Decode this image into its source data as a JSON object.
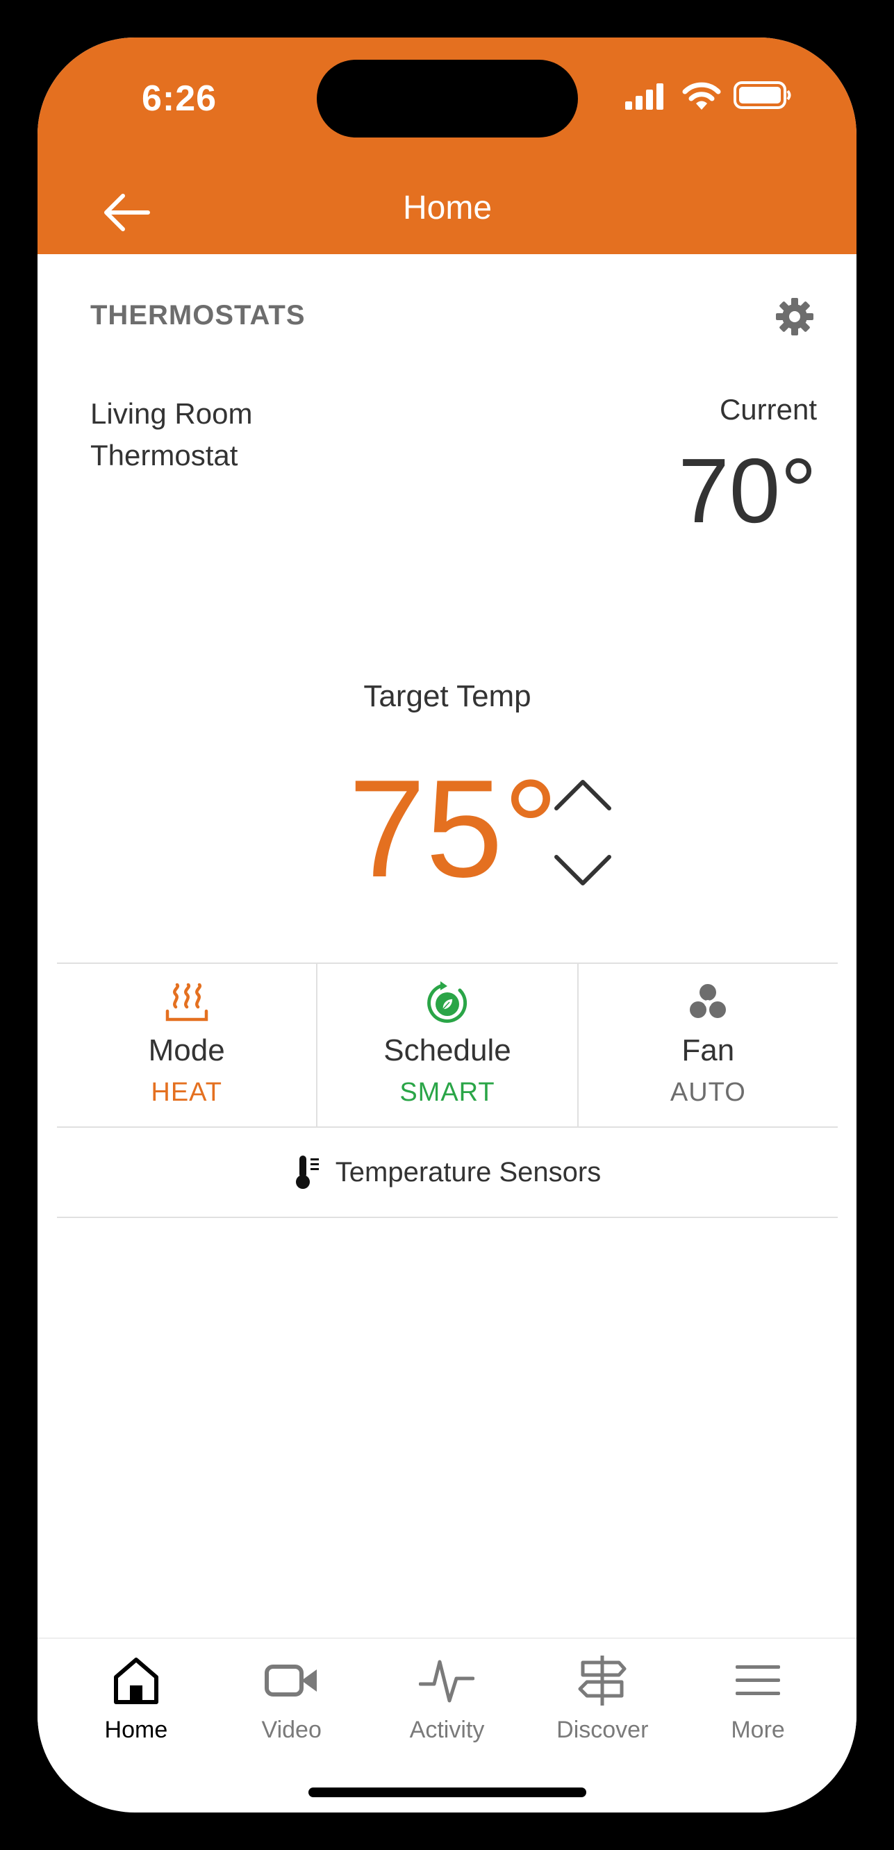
{
  "status_bar": {
    "time": "6:26",
    "icons": [
      "cellular-signal-icon",
      "wifi-icon",
      "battery-icon"
    ]
  },
  "header": {
    "title": "Home",
    "back_icon": "arrow-left-icon"
  },
  "thermostats": {
    "section_title": "THERMOSTATS",
    "settings_icon": "gear-icon",
    "name": "Living Room Thermostat",
    "current_label": "Current",
    "current_temp": "70°",
    "target_label": "Target Temp",
    "target_temp": "75°",
    "controls": [
      {
        "label": "Mode",
        "value": "HEAT",
        "icon": "heat-icon",
        "color": "#e47020"
      },
      {
        "label": "Schedule",
        "value": "SMART",
        "icon": "smart-schedule-icon",
        "color": "#2aa547"
      },
      {
        "label": "Fan",
        "value": "AUTO",
        "icon": "fan-icon",
        "color": "#6d6d6d"
      }
    ],
    "sensors_label": "Temperature Sensors"
  },
  "tab_bar": {
    "tabs": [
      {
        "label": "Home",
        "icon": "home-icon",
        "active": true
      },
      {
        "label": "Video",
        "icon": "video-icon",
        "active": false
      },
      {
        "label": "Activity",
        "icon": "activity-icon",
        "active": false
      },
      {
        "label": "Discover",
        "icon": "signpost-icon",
        "active": false
      },
      {
        "label": "More",
        "icon": "menu-icon",
        "active": false
      }
    ]
  },
  "colors": {
    "brand_orange": "#e47020",
    "smart_green": "#2aa547",
    "text_dark": "#333333",
    "text_muted": "#6d6d6d"
  }
}
